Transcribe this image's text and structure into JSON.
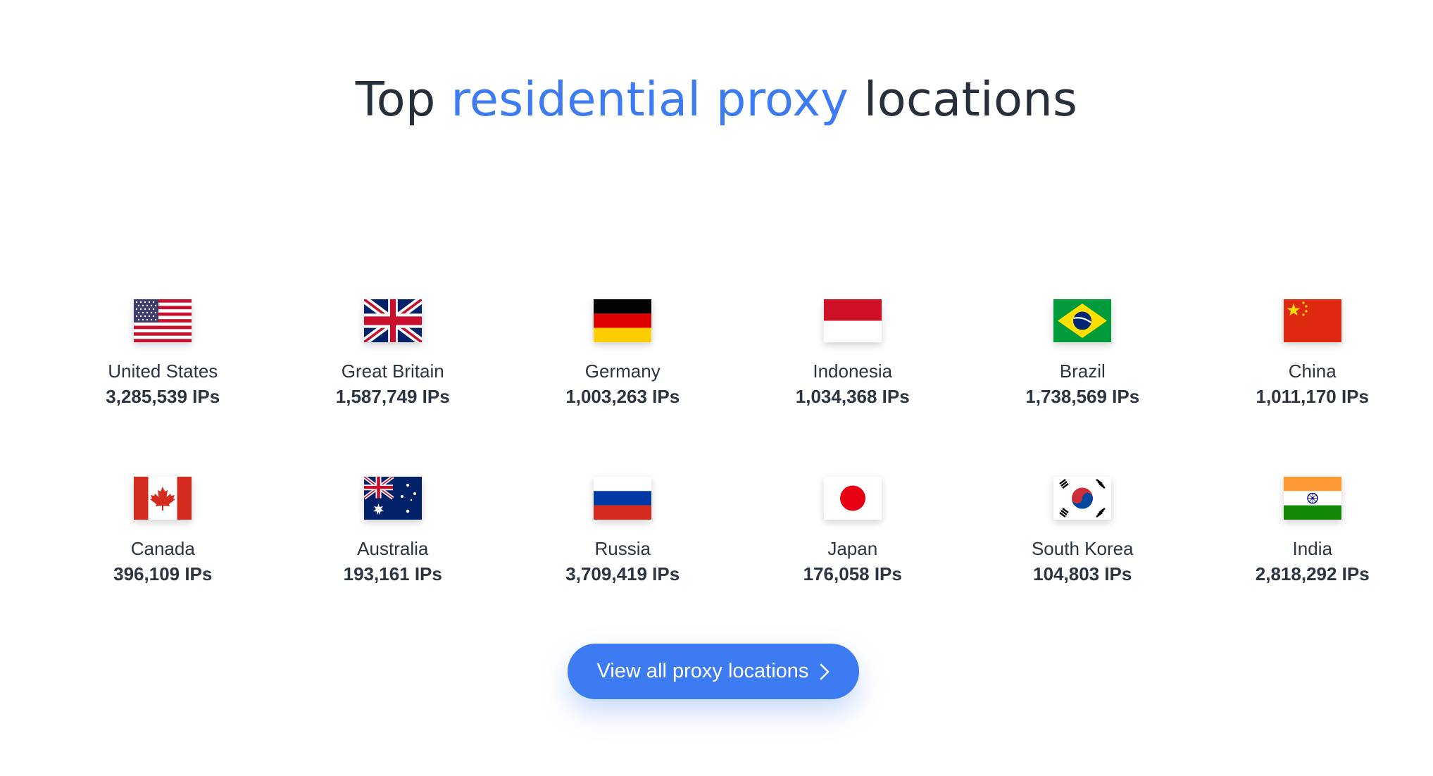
{
  "heading": {
    "prefix": "Top",
    "accent": "residential proxy",
    "suffix": "locations"
  },
  "locations": [
    {
      "name": "United States",
      "ips": "3,285,539 IPs",
      "flag": "us-flag"
    },
    {
      "name": "Great Britain",
      "ips": "1,587,749 IPs",
      "flag": "gb-flag"
    },
    {
      "name": "Germany",
      "ips": "1,003,263 IPs",
      "flag": "de-flag"
    },
    {
      "name": "Indonesia",
      "ips": "1,034,368 IPs",
      "flag": "id-flag"
    },
    {
      "name": "Brazil",
      "ips": "1,738,569 IPs",
      "flag": "br-flag"
    },
    {
      "name": "China",
      "ips": "1,011,170 IPs",
      "flag": "cn-flag"
    },
    {
      "name": "Canada",
      "ips": "396,109 IPs",
      "flag": "ca-flag"
    },
    {
      "name": "Australia",
      "ips": "193,161 IPs",
      "flag": "au-flag"
    },
    {
      "name": "Russia",
      "ips": "3,709,419 IPs",
      "flag": "ru-flag"
    },
    {
      "name": "Japan",
      "ips": "176,058 IPs",
      "flag": "jp-flag"
    },
    {
      "name": "South Korea",
      "ips": "104,803 IPs",
      "flag": "kr-flag"
    },
    {
      "name": "India",
      "ips": "2,818,292 IPs",
      "flag": "in-flag"
    }
  ],
  "cta": {
    "label": "View all proxy locations",
    "icon": "chevron-right-icon"
  },
  "colors": {
    "accent": "#3d7bf2",
    "text": "#2b3441",
    "background": "#ffffff"
  }
}
